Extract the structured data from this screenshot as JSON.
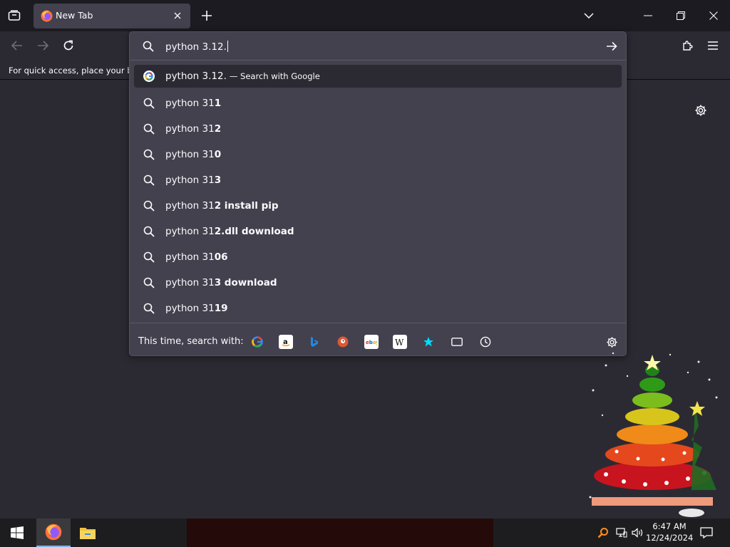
{
  "tab": {
    "title": "New Tab"
  },
  "bookmarks_bar": {
    "hint": "For quick access, place your boo"
  },
  "urlbar": {
    "value": "python 3.12."
  },
  "results": [
    {
      "prefix": "python 3.12.",
      "bold": "",
      "action": "— Search with Google",
      "icon": "google-icon",
      "selected": true
    },
    {
      "prefix": "python 31",
      "bold": "1",
      "action": "",
      "icon": "search-icon"
    },
    {
      "prefix": "python 31",
      "bold": "2",
      "action": "",
      "icon": "search-icon"
    },
    {
      "prefix": "python 31",
      "bold": "0",
      "action": "",
      "icon": "search-icon"
    },
    {
      "prefix": "python 31",
      "bold": "3",
      "action": "",
      "icon": "search-icon"
    },
    {
      "prefix": "python 31",
      "bold": "2 install pip",
      "action": "",
      "icon": "search-icon"
    },
    {
      "prefix": "python 31",
      "bold": "2.dll download",
      "action": "",
      "icon": "search-icon"
    },
    {
      "prefix": "python 31",
      "bold": "06",
      "action": "",
      "icon": "search-icon"
    },
    {
      "prefix": "python 31",
      "bold": "3 download",
      "action": "",
      "icon": "search-icon"
    },
    {
      "prefix": "python 31",
      "bold": "19",
      "action": "",
      "icon": "search-icon"
    }
  ],
  "oneoff": {
    "label": "This time, search with:",
    "engines": [
      "google-icon",
      "amazon-icon",
      "bing-icon",
      "duckduckgo-icon",
      "ebay-icon",
      "wikipedia-icon",
      "bookmarks-star-icon",
      "tabs-icon",
      "history-icon"
    ]
  },
  "taskbar": {
    "time": "6:47 AM",
    "date": "12/24/2024"
  },
  "colors": {
    "accent": "#7eb3e6",
    "panel": "#42414d",
    "background": "#2b2a33",
    "tabstrip": "#1c1b22"
  }
}
